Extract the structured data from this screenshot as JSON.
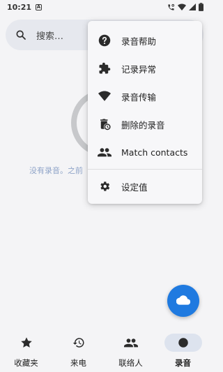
{
  "status_bar": {
    "time": "10:21",
    "app_badge": "A",
    "icons": [
      "call-recording-icon",
      "wifi-icon",
      "signal-icon",
      "battery-icon"
    ]
  },
  "search": {
    "placeholder": "搜索…"
  },
  "empty_state": {
    "message": "没有录音。之前"
  },
  "menu": {
    "items": [
      {
        "label": "录音帮助",
        "icon": "help-icon"
      },
      {
        "label": "记录异常",
        "icon": "puzzle-icon"
      },
      {
        "label": "录音传输",
        "icon": "wifi-icon"
      },
      {
        "label": "删除的录音",
        "icon": "trash-clock-icon"
      },
      {
        "label": "Match contacts",
        "icon": "contacts-icon"
      },
      {
        "label": "设定值",
        "icon": "settings-icon"
      }
    ]
  },
  "fab": {
    "icon": "cloud-icon",
    "color": "#1f7ae0"
  },
  "bottom_nav": {
    "items": [
      {
        "label": "收藏夹",
        "icon": "star-icon",
        "active": false
      },
      {
        "label": "来电",
        "icon": "history-icon",
        "active": false
      },
      {
        "label": "联络人",
        "icon": "contacts-icon",
        "active": false
      },
      {
        "label": "录音",
        "icon": "record-icon",
        "active": true
      }
    ]
  }
}
